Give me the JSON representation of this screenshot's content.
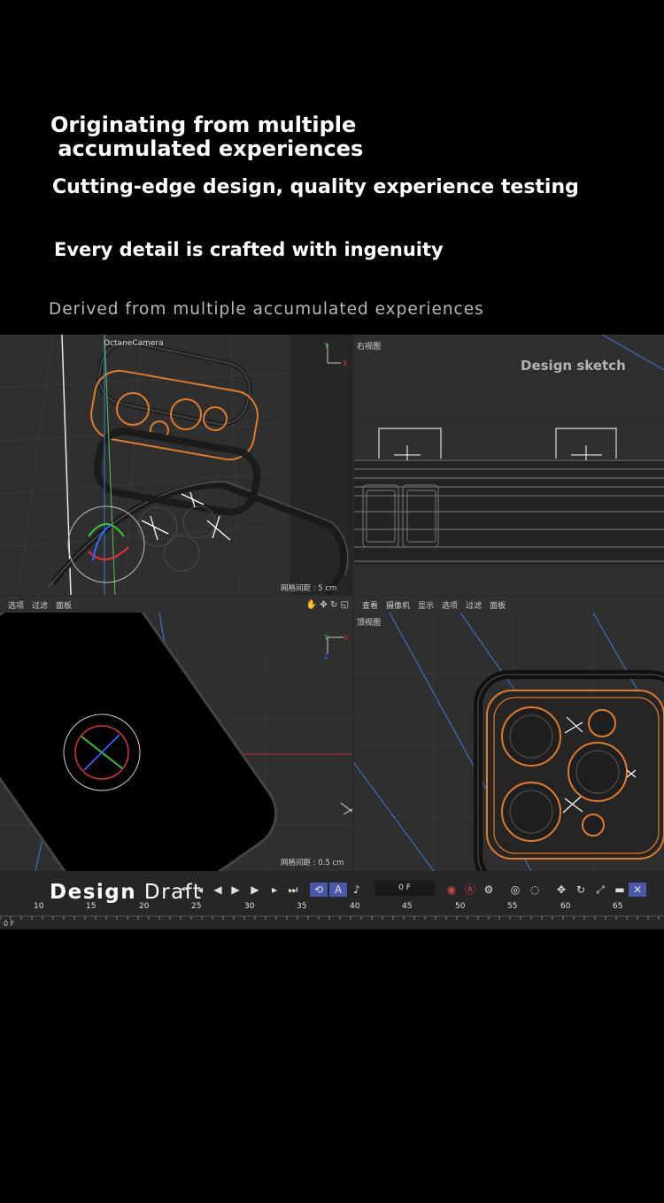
{
  "hero": {
    "heading_line1": "Originating from multiple",
    "heading_line2": " accumulated experiences",
    "subheading": "Cutting-edge design, quality experience testing",
    "tagline": "Every detail is crafted with ingenuity",
    "caption": "Derived from multiple accumulated experiences"
  },
  "viewports": {
    "perspective": {
      "camera_label": "OctaneCamera",
      "grid_spacing": "网格间距 : 5 cm"
    },
    "right": {
      "title": "右视图",
      "overlay": "Design sketch"
    },
    "front": {
      "grid_spacing": "网格间距 : 0.5 cm"
    },
    "top": {
      "title": "顶视图"
    }
  },
  "menus": {
    "left": [
      "选项",
      "过滤",
      "面板"
    ],
    "right": [
      "查看",
      "摄像机",
      "显示",
      "选项",
      "过滤",
      "面板"
    ]
  },
  "timeline": {
    "overlay_bold": "Design",
    "overlay_light": " Draft",
    "frame_value": "0 F",
    "ruler_numbers": [
      "10",
      "15",
      "20",
      "25",
      "30",
      "35",
      "40",
      "45",
      "50",
      "55",
      "60",
      "65"
    ],
    "current_frame": "0 F",
    "transport_icons": [
      "go-to-start-icon",
      "prev-key-icon",
      "prev-frame-icon",
      "play-icon",
      "next-frame-icon",
      "next-key-icon",
      "go-to-end-icon"
    ]
  },
  "colors": {
    "accent_orange": "#e07b2a",
    "grid_blue": "#3b7bd6",
    "axis_red": "#d33",
    "axis_green": "#3c3",
    "axis_blue": "#36f"
  }
}
